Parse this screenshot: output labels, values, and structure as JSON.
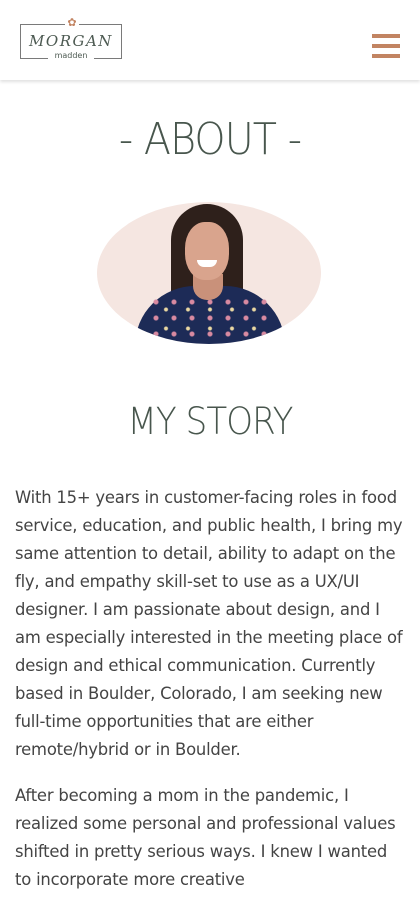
{
  "header": {
    "logo": {
      "name": "MORGAN",
      "sub": "madden"
    },
    "menu_icon": "hamburger-menu-icon"
  },
  "about": {
    "heading": "- ABOUT -"
  },
  "story": {
    "heading": "MY STORY",
    "paragraphs": [
      "With 15+ years in customer-facing roles in food service, education, and public health, I bring my same attention to detail, ability to adapt on the fly, and empathy skill-set to use as a UX/UI designer. I am passionate about design, and I am especially interested in the meeting place of design and ethical communication. Currently based in Boulder, Colorado, I am seeking new full-time opportunities that are either remote/hybrid or in Boulder.",
      "After becoming a mom in the pandemic, I realized some personal and professional values shifted in pretty serious ways. I knew I wanted to incorporate more creative"
    ]
  },
  "colors": {
    "accent": "#c28462",
    "heading": "#48564d",
    "portrait_bg": "#f5e6e1"
  }
}
